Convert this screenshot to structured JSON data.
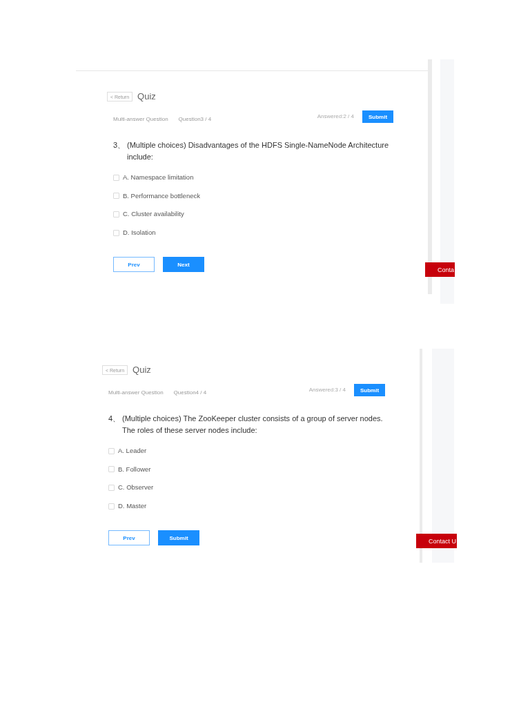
{
  "screenshots": [
    {
      "return_button": "< Return",
      "title": "Quiz",
      "question_type": "Multi-answer Question",
      "question_counter": "Question3 / 4",
      "answered": "Answered:2 / 4",
      "submit_button": "Submit",
      "question": {
        "number": "3、",
        "text": "(Multiple choices) Disadvantages of the HDFS Single-NameNode Architecture include:"
      },
      "options": [
        {
          "label": "A. Namespace limitation",
          "checked": false
        },
        {
          "label": "B. Performance bottleneck",
          "checked": false
        },
        {
          "label": "C. Cluster availability",
          "checked": false
        },
        {
          "label": "D. Isolation",
          "checked": false
        }
      ],
      "nav_buttons": [
        {
          "label": "Prev",
          "kind": "prev"
        },
        {
          "label": "Next",
          "kind": "next"
        }
      ],
      "contact_button": "Conta"
    },
    {
      "return_button": "< Return",
      "title": "Quiz",
      "question_type": "Multi-answer Question",
      "question_counter": "Question4 / 4",
      "answered": "Answered:3 / 4",
      "submit_button": "Submit",
      "question": {
        "number": "4、",
        "text": "(Multiple choices) The ZooKeeper cluster consists of a group of server nodes. The roles of these server nodes include:"
      },
      "options": [
        {
          "label": "A. Leader",
          "checked": false
        },
        {
          "label": "B. Follower",
          "checked": false
        },
        {
          "label": "C. Observer",
          "checked": false
        },
        {
          "label": "D. Master",
          "checked": false
        }
      ],
      "nav_buttons": [
        {
          "label": "Prev",
          "kind": "prev"
        },
        {
          "label": "Submit",
          "kind": "submit"
        }
      ],
      "contact_button": "Contact U"
    }
  ]
}
